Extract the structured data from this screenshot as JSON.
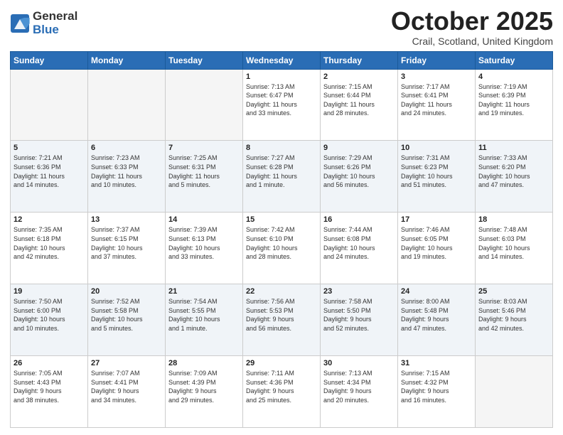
{
  "header": {
    "logo_general": "General",
    "logo_blue": "Blue",
    "month": "October 2025",
    "location": "Crail, Scotland, United Kingdom"
  },
  "days_of_week": [
    "Sunday",
    "Monday",
    "Tuesday",
    "Wednesday",
    "Thursday",
    "Friday",
    "Saturday"
  ],
  "weeks": [
    [
      {
        "day": "",
        "info": ""
      },
      {
        "day": "",
        "info": ""
      },
      {
        "day": "",
        "info": ""
      },
      {
        "day": "1",
        "info": "Sunrise: 7:13 AM\nSunset: 6:47 PM\nDaylight: 11 hours\nand 33 minutes."
      },
      {
        "day": "2",
        "info": "Sunrise: 7:15 AM\nSunset: 6:44 PM\nDaylight: 11 hours\nand 28 minutes."
      },
      {
        "day": "3",
        "info": "Sunrise: 7:17 AM\nSunset: 6:41 PM\nDaylight: 11 hours\nand 24 minutes."
      },
      {
        "day": "4",
        "info": "Sunrise: 7:19 AM\nSunset: 6:39 PM\nDaylight: 11 hours\nand 19 minutes."
      }
    ],
    [
      {
        "day": "5",
        "info": "Sunrise: 7:21 AM\nSunset: 6:36 PM\nDaylight: 11 hours\nand 14 minutes."
      },
      {
        "day": "6",
        "info": "Sunrise: 7:23 AM\nSunset: 6:33 PM\nDaylight: 11 hours\nand 10 minutes."
      },
      {
        "day": "7",
        "info": "Sunrise: 7:25 AM\nSunset: 6:31 PM\nDaylight: 11 hours\nand 5 minutes."
      },
      {
        "day": "8",
        "info": "Sunrise: 7:27 AM\nSunset: 6:28 PM\nDaylight: 11 hours\nand 1 minute."
      },
      {
        "day": "9",
        "info": "Sunrise: 7:29 AM\nSunset: 6:26 PM\nDaylight: 10 hours\nand 56 minutes."
      },
      {
        "day": "10",
        "info": "Sunrise: 7:31 AM\nSunset: 6:23 PM\nDaylight: 10 hours\nand 51 minutes."
      },
      {
        "day": "11",
        "info": "Sunrise: 7:33 AM\nSunset: 6:20 PM\nDaylight: 10 hours\nand 47 minutes."
      }
    ],
    [
      {
        "day": "12",
        "info": "Sunrise: 7:35 AM\nSunset: 6:18 PM\nDaylight: 10 hours\nand 42 minutes."
      },
      {
        "day": "13",
        "info": "Sunrise: 7:37 AM\nSunset: 6:15 PM\nDaylight: 10 hours\nand 37 minutes."
      },
      {
        "day": "14",
        "info": "Sunrise: 7:39 AM\nSunset: 6:13 PM\nDaylight: 10 hours\nand 33 minutes."
      },
      {
        "day": "15",
        "info": "Sunrise: 7:42 AM\nSunset: 6:10 PM\nDaylight: 10 hours\nand 28 minutes."
      },
      {
        "day": "16",
        "info": "Sunrise: 7:44 AM\nSunset: 6:08 PM\nDaylight: 10 hours\nand 24 minutes."
      },
      {
        "day": "17",
        "info": "Sunrise: 7:46 AM\nSunset: 6:05 PM\nDaylight: 10 hours\nand 19 minutes."
      },
      {
        "day": "18",
        "info": "Sunrise: 7:48 AM\nSunset: 6:03 PM\nDaylight: 10 hours\nand 14 minutes."
      }
    ],
    [
      {
        "day": "19",
        "info": "Sunrise: 7:50 AM\nSunset: 6:00 PM\nDaylight: 10 hours\nand 10 minutes."
      },
      {
        "day": "20",
        "info": "Sunrise: 7:52 AM\nSunset: 5:58 PM\nDaylight: 10 hours\nand 5 minutes."
      },
      {
        "day": "21",
        "info": "Sunrise: 7:54 AM\nSunset: 5:55 PM\nDaylight: 10 hours\nand 1 minute."
      },
      {
        "day": "22",
        "info": "Sunrise: 7:56 AM\nSunset: 5:53 PM\nDaylight: 9 hours\nand 56 minutes."
      },
      {
        "day": "23",
        "info": "Sunrise: 7:58 AM\nSunset: 5:50 PM\nDaylight: 9 hours\nand 52 minutes."
      },
      {
        "day": "24",
        "info": "Sunrise: 8:00 AM\nSunset: 5:48 PM\nDaylight: 9 hours\nand 47 minutes."
      },
      {
        "day": "25",
        "info": "Sunrise: 8:03 AM\nSunset: 5:46 PM\nDaylight: 9 hours\nand 42 minutes."
      }
    ],
    [
      {
        "day": "26",
        "info": "Sunrise: 7:05 AM\nSunset: 4:43 PM\nDaylight: 9 hours\nand 38 minutes."
      },
      {
        "day": "27",
        "info": "Sunrise: 7:07 AM\nSunset: 4:41 PM\nDaylight: 9 hours\nand 34 minutes."
      },
      {
        "day": "28",
        "info": "Sunrise: 7:09 AM\nSunset: 4:39 PM\nDaylight: 9 hours\nand 29 minutes."
      },
      {
        "day": "29",
        "info": "Sunrise: 7:11 AM\nSunset: 4:36 PM\nDaylight: 9 hours\nand 25 minutes."
      },
      {
        "day": "30",
        "info": "Sunrise: 7:13 AM\nSunset: 4:34 PM\nDaylight: 9 hours\nand 20 minutes."
      },
      {
        "day": "31",
        "info": "Sunrise: 7:15 AM\nSunset: 4:32 PM\nDaylight: 9 hours\nand 16 minutes."
      },
      {
        "day": "",
        "info": ""
      }
    ]
  ]
}
